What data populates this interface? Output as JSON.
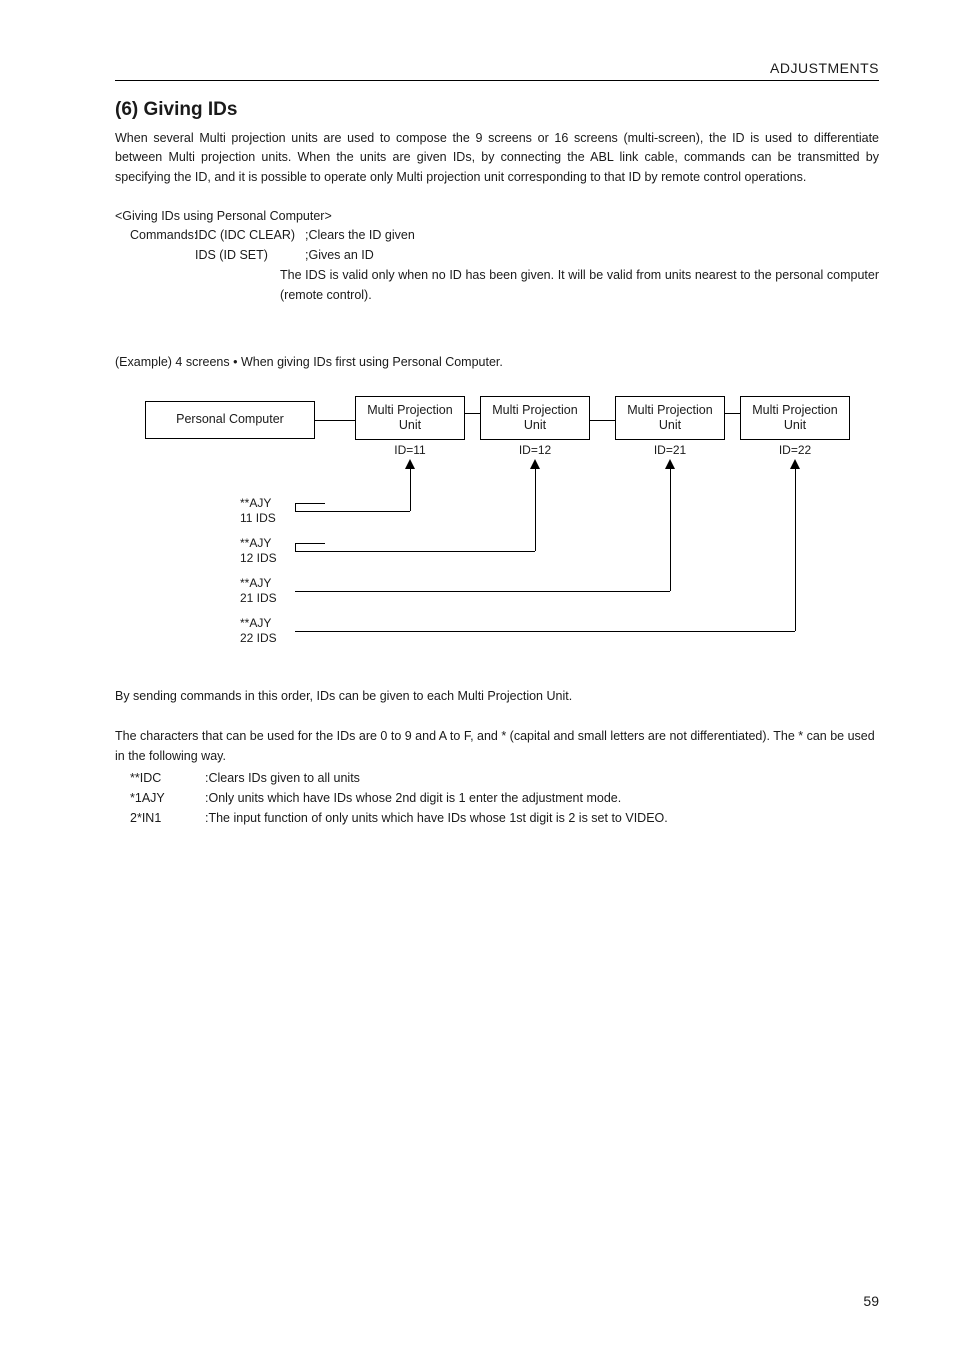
{
  "runningHead": "ADJUSTMENTS",
  "sectionTitle": "(6) Giving IDs",
  "intro": "When several Multi projection units are used to compose the 9 screens or 16 screens (multi-screen), the ID is used to differentiate between Multi projection units. When the units are given IDs, by connecting the ABL link cable, commands can be transmitted by specifying the ID, and it is possible to operate only Multi projection unit corresponding to that ID by remote control operations.",
  "givingIdsHead": "<Giving IDs using Personal Computer>",
  "cmd": {
    "label": "Commands: ",
    "idc_cmd": "IDC (IDC CLEAR)",
    "idc_desc": ";Clears the ID given",
    "ids_cmd": "IDS (ID SET)",
    "ids_desc": ";Gives an ID",
    "note": "The IDS is valid only when no ID has been given. It will be valid from units nearest to the personal computer (remote control)."
  },
  "exampleLine": "(Example) 4 screens  • When giving IDs first using Personal Computer.",
  "diagram": {
    "pc": "Personal Computer",
    "unit": "Multi Projection Unit",
    "id1": "ID=11",
    "id2": "ID=12",
    "id3": "ID=21",
    "id4": "ID=22",
    "l1a": "**AJY",
    "l1b": "11 IDS",
    "l2a": "**AJY",
    "l2b": "12 IDS",
    "l3a": "**AJY",
    "l3b": "21 IDS",
    "l4a": "**AJY",
    "l4b": "22 IDS"
  },
  "closing1": "By sending commands in this order, IDs can be given to each Multi Projection Unit.",
  "closing2": "The characters that can be used for the IDs are 0 to 9 and A to F, and * (capital and small letters are not differentiated). The * can be used in the following way.",
  "defs": [
    {
      "term": "**IDC",
      "desc": ":Clears IDs given to all units"
    },
    {
      "term": "*1AJY",
      "desc": ":Only units which have IDs whose 2nd digit is 1 enter the adjustment mode."
    },
    {
      "term": "2*IN1",
      "desc": ":The input function of only units which have IDs whose 1st digit is 2 is set to VIDEO."
    }
  ],
  "pageNumber": "59"
}
